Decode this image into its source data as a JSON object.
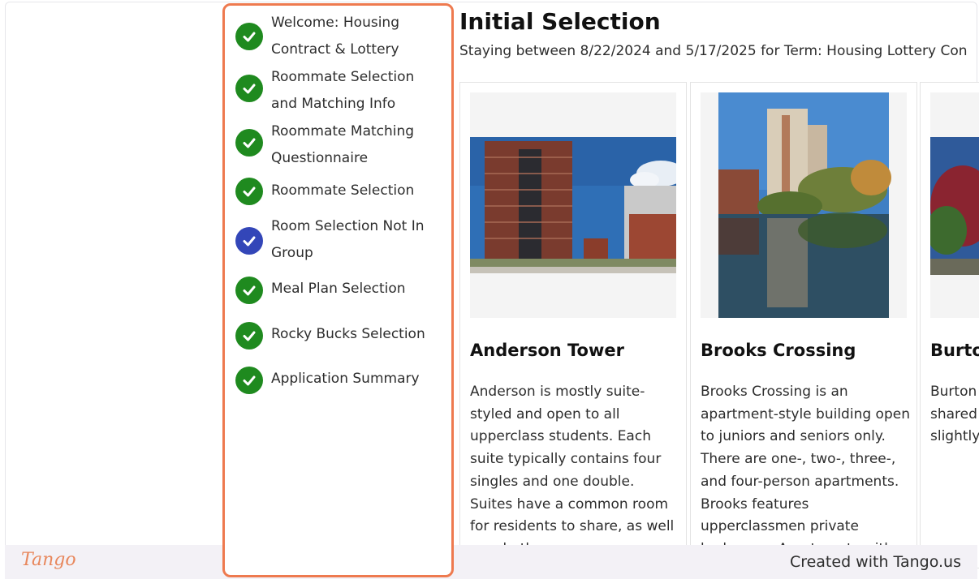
{
  "steps": [
    {
      "label": "Welcome: Housing Contract & Lottery",
      "state": "complete"
    },
    {
      "label": "Roommate Selection and Matching Info",
      "state": "complete"
    },
    {
      "label": "Roommate Matching Questionnaire",
      "state": "complete"
    },
    {
      "label": "Roommate Selection",
      "state": "complete"
    },
    {
      "label": "Room Selection Not In Group",
      "state": "current"
    },
    {
      "label": "Meal Plan Selection",
      "state": "complete"
    },
    {
      "label": "Rocky Bucks Selection",
      "state": "complete"
    },
    {
      "label": "Application Summary",
      "state": "complete"
    }
  ],
  "main": {
    "title": "Initial Selection",
    "subtitle": "Staying between 8/22/2024 and 5/17/2025 for Term: Housing Lottery Con"
  },
  "cards": [
    {
      "name": "Anderson Tower",
      "description": "Anderson is mostly suite-styled and open to all upperclass students. Each suite typically contains four singles and one double. Suites have a common room for residents to share, as well as a bathroom"
    },
    {
      "name": "Brooks Crossing",
      "description": "Brooks Crossing is an apartment-style building open to juniors and seniors only. There are one-, two-, three-, and four-person apartments. Brooks features upperclassmen private bedrooms. Apartments with"
    },
    {
      "name": "Burto",
      "description": "Burton style ho and sin shared All roor third flo slightly"
    }
  ],
  "footer": {
    "logo": "Tango",
    "credit": "Created with Tango.us"
  },
  "colors": {
    "complete": "#1f8a1f",
    "current": "#3346b8",
    "highlight_border": "#ee7a4f"
  }
}
